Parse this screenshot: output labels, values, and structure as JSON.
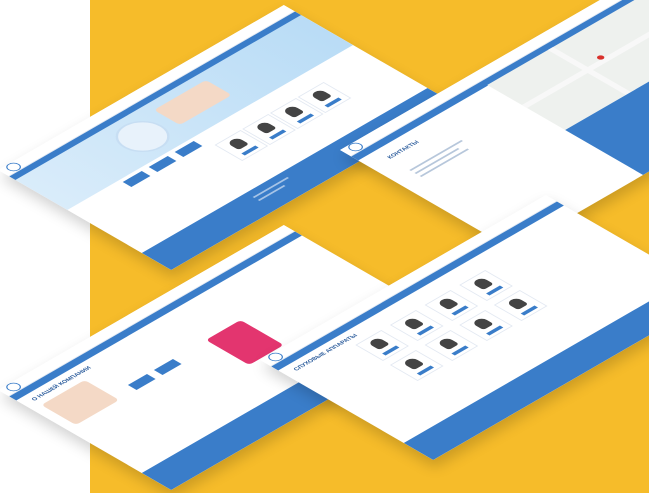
{
  "colors": {
    "background": "#f6bc2a",
    "brand": "#3a7dc9",
    "page": "#ffffff"
  },
  "mockups": [
    {
      "id": "home",
      "heading": ""
    },
    {
      "id": "contacts",
      "heading": "КОНТАКТЫ"
    },
    {
      "id": "about",
      "heading": "О НАШЕЙ КОМПАНИИ"
    },
    {
      "id": "catalog",
      "heading": "СЛУХОВЫЕ АППАРАТЫ"
    }
  ]
}
